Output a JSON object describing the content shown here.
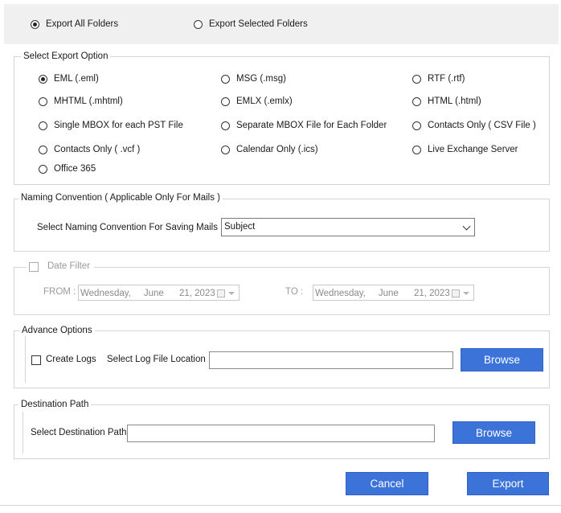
{
  "export_scope": {
    "all_label": "Export All Folders",
    "selected_label": "Export Selected Folders",
    "selected": "all"
  },
  "export_option": {
    "legend": "Select Export Option",
    "options": [
      {
        "label": "EML  (.eml)",
        "checked": true
      },
      {
        "label": "MSG  (.msg)",
        "checked": false
      },
      {
        "label": "RTF  (.rtf)",
        "checked": false
      },
      {
        "label": "MHTML (.mhtml)",
        "checked": false
      },
      {
        "label": "EMLX  (.emlx)",
        "checked": false
      },
      {
        "label": "HTML  (.html)",
        "checked": false
      },
      {
        "label": "Single MBOX for each PST File",
        "checked": false
      },
      {
        "label": "Separate MBOX File for Each Folder",
        "checked": false
      },
      {
        "label": "Contacts Only  ( CSV File )",
        "checked": false
      },
      {
        "label": "Contacts Only  ( .vcf )",
        "checked": false
      },
      {
        "label": "Calendar Only  (.ics)",
        "checked": false
      },
      {
        "label": "Live Exchange Server",
        "checked": false
      },
      {
        "label": "Office 365",
        "checked": false
      }
    ]
  },
  "naming": {
    "legend": "Naming Convention ( Applicable Only For Mails )",
    "label": "Select Naming Convention For Saving Mails",
    "value": "Subject"
  },
  "date_filter": {
    "label": "Date Filter",
    "enabled": false,
    "from_label": "FROM :",
    "to_label": "TO :",
    "from_value": "Wednesday,     June      21, 2023",
    "to_value": "Wednesday,     June      21, 2023"
  },
  "advance": {
    "legend": "Advance Options",
    "create_logs_label": "Create Logs",
    "log_location_label": "Select Log File Location :",
    "log_location_value": "",
    "browse_label": "Browse"
  },
  "destination": {
    "legend": "Destination Path",
    "label": "Select Destination Path",
    "value": "",
    "browse_label": "Browse"
  },
  "actions": {
    "cancel_label": "Cancel",
    "export_label": "Export"
  },
  "colors": {
    "button_blue": "#3c73d9",
    "top_bar": "#f0f0f0",
    "group_border": "#d5d5d5"
  }
}
